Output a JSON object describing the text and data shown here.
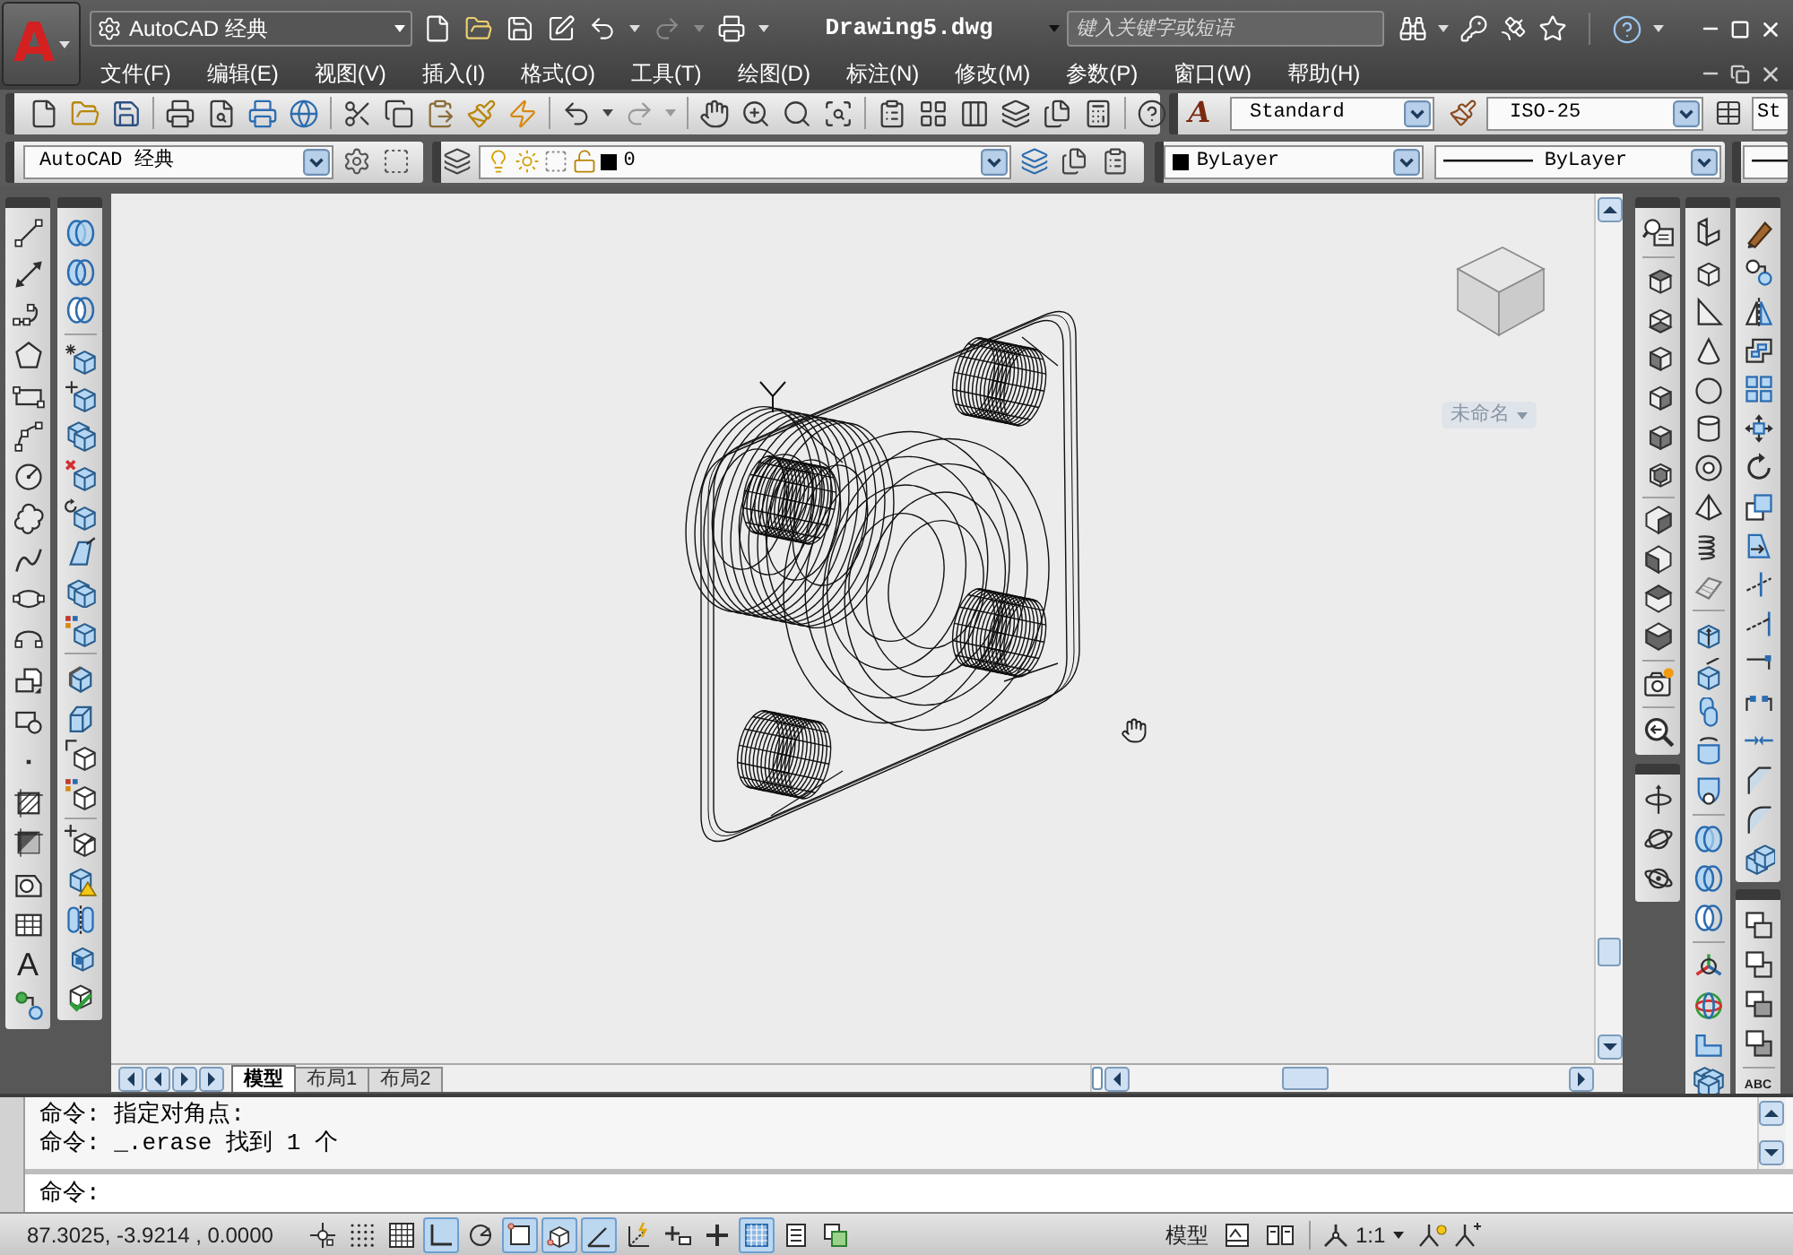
{
  "app_menu": {
    "logo": "A"
  },
  "title_bar": {
    "workspace": "AutoCAD 经典",
    "document_title": "Drawing5.dwg",
    "search": {
      "placeholder": "键入关键字或短语"
    }
  },
  "menu_bar": [
    {
      "label": "文件(F)"
    },
    {
      "label": "编辑(E)"
    },
    {
      "label": "视图(V)"
    },
    {
      "label": "插入(I)"
    },
    {
      "label": "格式(O)"
    },
    {
      "label": "工具(T)"
    },
    {
      "label": "绘图(D)"
    },
    {
      "label": "标注(N)"
    },
    {
      "label": "修改(M)"
    },
    {
      "label": "参数(P)"
    },
    {
      "label": "窗口(W)"
    },
    {
      "label": "帮助(H)"
    }
  ],
  "styles_toolbar": {
    "text_style_glyph": "A",
    "text_style": "Standard",
    "dimension_style": "ISO-25",
    "cut_off_dropdown": "St"
  },
  "workspaces_toolbar": {
    "workspace": "AutoCAD 经典"
  },
  "layers_toolbar": {
    "current_layer": "0"
  },
  "properties_toolbar": {
    "swatch_label": "ByLayer",
    "linetype": "ByLayer"
  },
  "draw_toolbar": {
    "text_glyph": "A"
  },
  "draw_order_toolbar": {
    "text_glyph": "ABC"
  },
  "viewcube": {
    "ucs_name": "未命名"
  },
  "layout_tabs": [
    {
      "label": "模型",
      "selected": true
    },
    {
      "label": "布局1",
      "selected": false
    },
    {
      "label": "布局2",
      "selected": false
    }
  ],
  "command_window": {
    "history": [
      "命令: 指定对角点:",
      "命令: _.erase 找到 1 个"
    ],
    "prompt": "命令:"
  },
  "status_bar": {
    "coordinates": "87.3025, -3.9214 , 0.0000",
    "toggles": [
      {
        "on": false
      },
      {
        "on": false
      },
      {
        "on": false
      },
      {
        "on": true
      },
      {
        "on": false
      },
      {
        "on": true
      },
      {
        "on": true
      },
      {
        "on": true
      },
      {
        "on": false
      },
      {
        "on": false
      },
      {
        "on": false
      },
      {
        "on": true
      },
      {
        "on": false
      },
      {
        "on": false
      }
    ],
    "model_button": "模型",
    "annotation_scale": "1:1"
  }
}
